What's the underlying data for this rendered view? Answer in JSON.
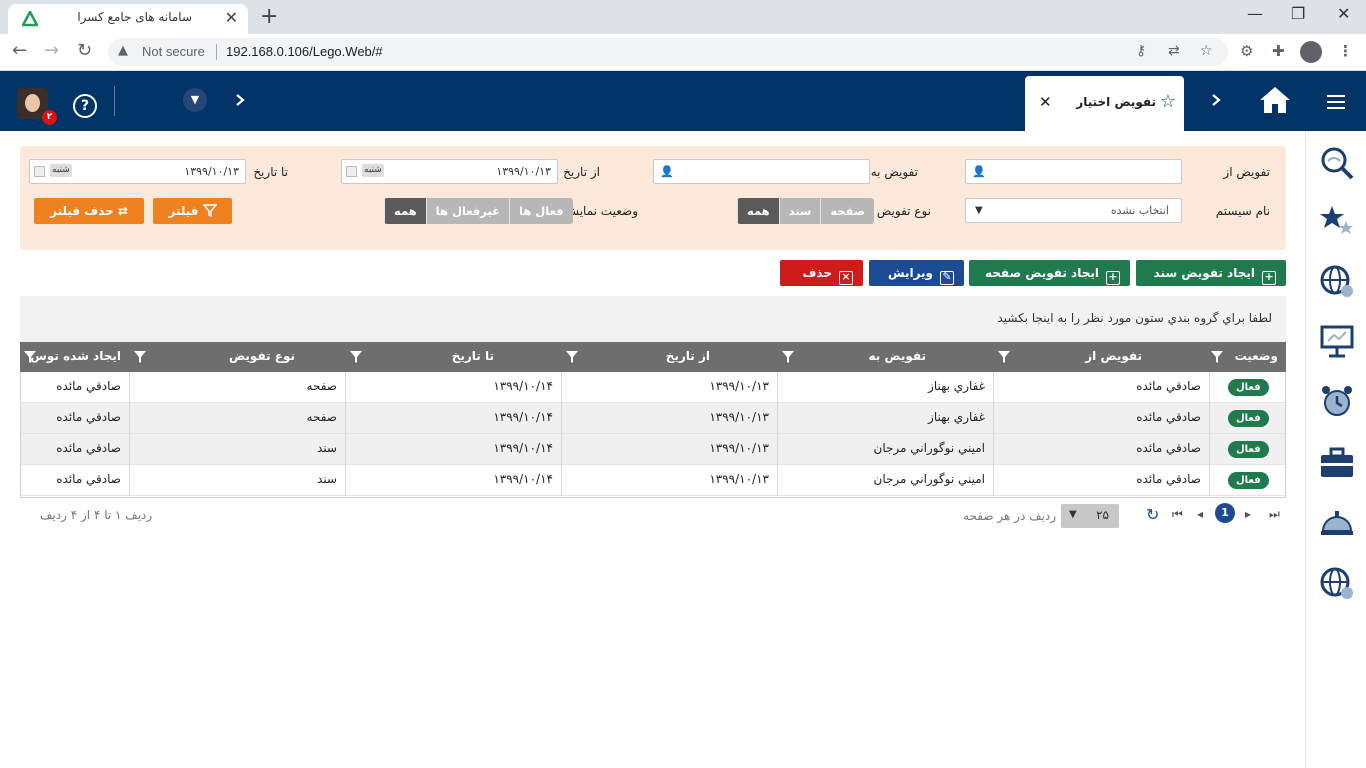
{
  "browser": {
    "tab_title": "سامانه های جامع کسرا",
    "not_secure": "Not secure",
    "url": "192.168.0.106/Lego.Web/#",
    "icons": [
      "back-icon",
      "forward-icon",
      "reload-icon",
      "key-icon",
      "translate-icon",
      "star-icon",
      "extensions-icon",
      "profile-icon"
    ]
  },
  "header": {
    "tab_label": "تفویض اختیار",
    "notification_count": "۲",
    "help_label": "?"
  },
  "filter": {
    "from_label": "تفویض از",
    "to_label": "تفویض به",
    "from_date_label": "از تاریخ",
    "to_date_label": "تا تاریخ",
    "from_date_value": "۱۳۹۹/۱۰/۱۳",
    "from_date_day": "شنبه",
    "to_date_value": "۱۳۹۹/۱۰/۱۳",
    "to_date_day": "شنبه",
    "system_label": "نام سیستم",
    "system_value": "انتخاب نشده",
    "type_label": "نوع تفویض",
    "type_options": [
      "همه",
      "سند",
      "صفحه"
    ],
    "type_selected": "همه",
    "status_label": "وضعیت نمایش",
    "status_options": [
      "همه",
      "غیرفعال ها",
      "فعال ها"
    ],
    "status_selected": "همه",
    "filter_button": "فیلتر",
    "clear_button": "حذف فیلتر"
  },
  "toolbar": {
    "create_doc": "ایجاد تفویض سند",
    "create_page": "ایجاد تفویض صفحه",
    "edit": "ویرایش",
    "delete": "حذف"
  },
  "grid": {
    "group_hint": "لطفا براي گروه بندي ستون مورد نظر را به اينجا بکشيد",
    "columns": [
      "وضعیت",
      "تفویض از",
      "تفویض به",
      "از تاریخ",
      "تا تاریخ",
      "نوع تفویض",
      "ایجاد شده توس"
    ],
    "rows": [
      {
        "status": "فعال",
        "from": "صادقي مائده",
        "to": "غفاري بهناز",
        "from_date": "۱۳۹۹/۱۰/۱۳",
        "to_date": "۱۳۹۹/۱۰/۱۴",
        "type": "صفحه",
        "created_by": "صادقي مائده"
      },
      {
        "status": "فعال",
        "from": "صادقي مائده",
        "to": "غفاري بهناز",
        "from_date": "۱۳۹۹/۱۰/۱۳",
        "to_date": "۱۳۹۹/۱۰/۱۴",
        "type": "صفحه",
        "created_by": "صادقي مائده"
      },
      {
        "status": "فعال",
        "from": "صادقي مائده",
        "to": "اميني نوگوراني مرجان",
        "from_date": "۱۳۹۹/۱۰/۱۳",
        "to_date": "۱۳۹۹/۱۰/۱۴",
        "type": "سند",
        "created_by": "صادقي مائده"
      },
      {
        "status": "فعال",
        "from": "صادقي مائده",
        "to": "اميني نوگوراني مرجان",
        "from_date": "۱۳۹۹/۱۰/۱۳",
        "to_date": "۱۳۹۹/۱۰/۱۴",
        "type": "سند",
        "created_by": "صادقي مائده"
      }
    ]
  },
  "pager": {
    "current_page": "1",
    "page_size": "۲۵",
    "page_size_label": "ردیف در هر صفحه",
    "info": "ردیف ۱ تا ۴ از ۴ ردیف"
  },
  "colors": {
    "header_bg": "#003366",
    "filter_bg": "#fce9da",
    "accent_orange": "#ee8120",
    "green": "#1f7a4d",
    "blue": "#1c4b94",
    "red": "#d01b1b"
  }
}
